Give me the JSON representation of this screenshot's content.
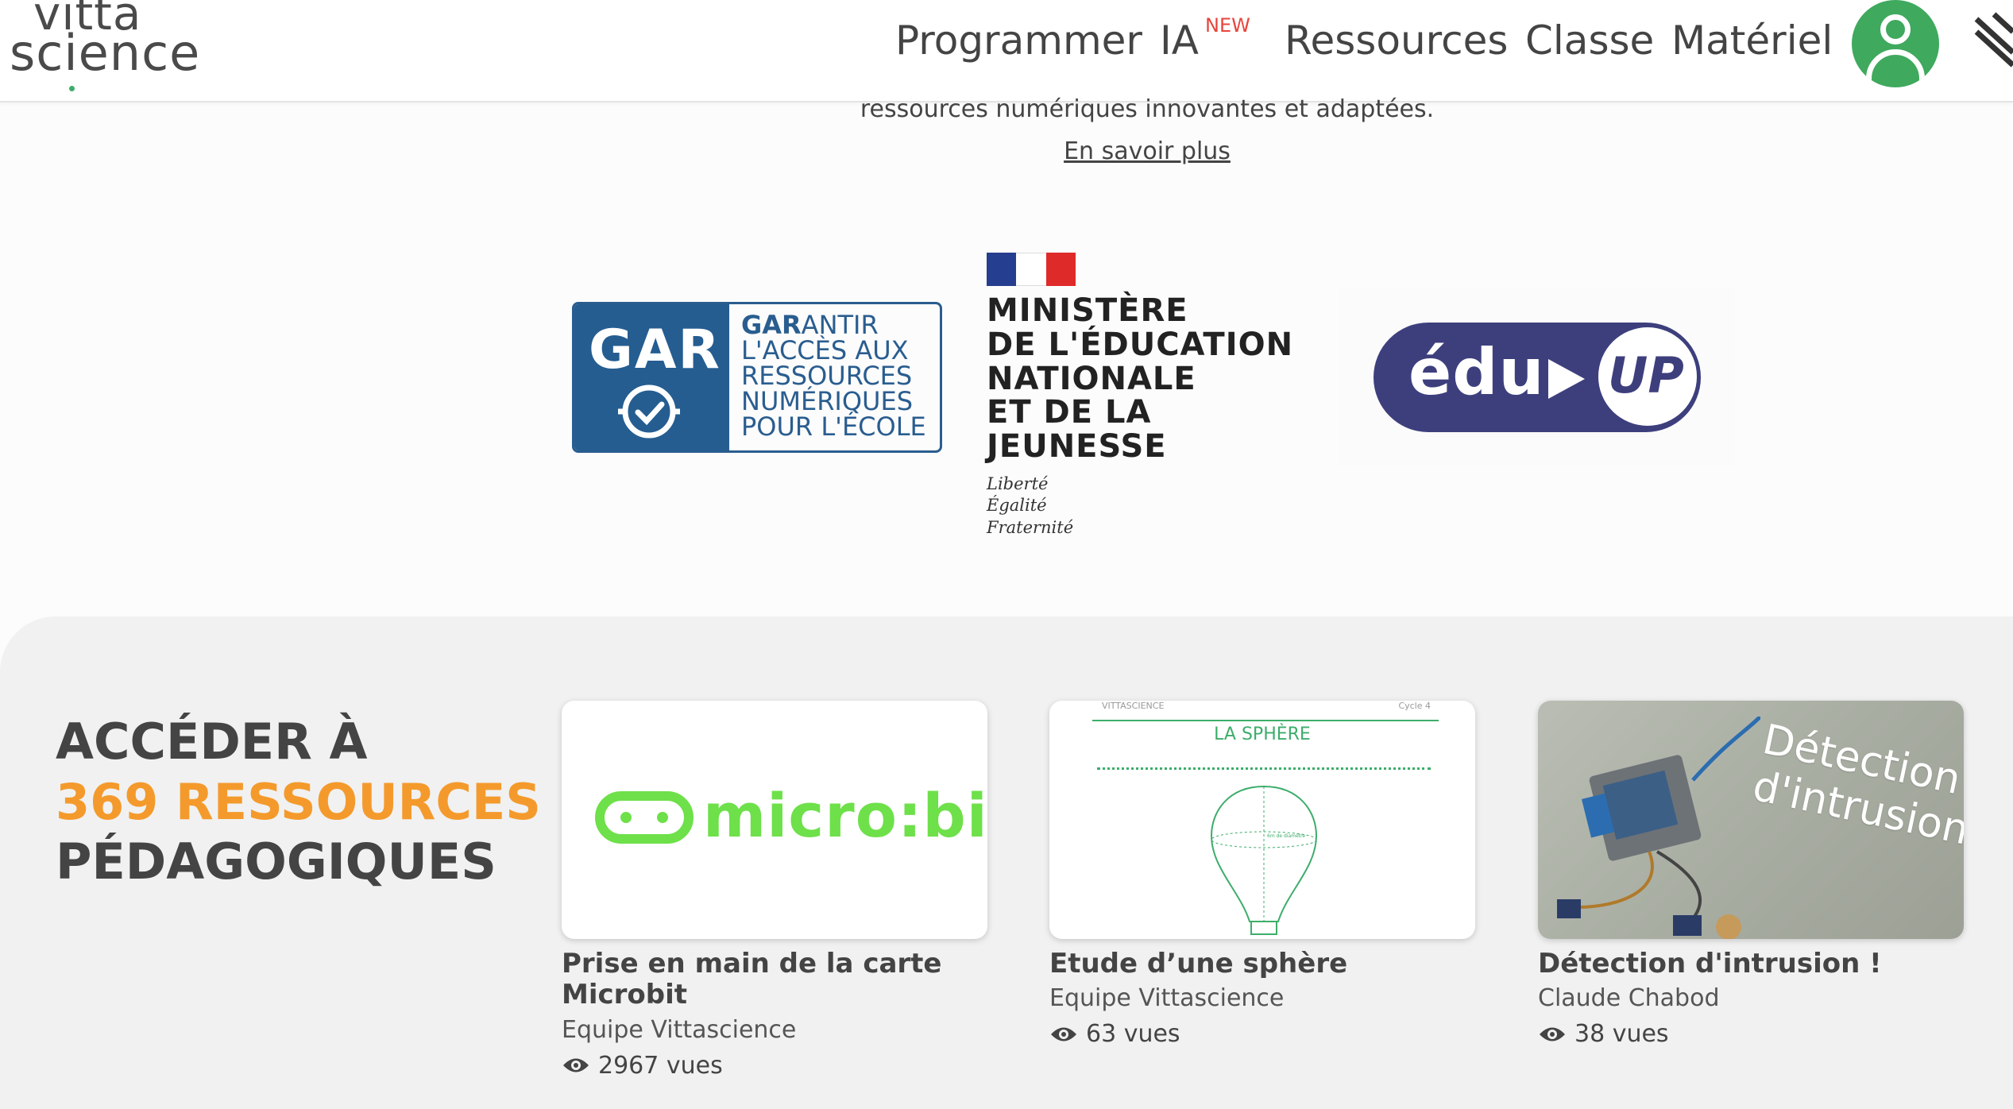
{
  "header": {
    "logo_line1": "vitta",
    "logo_line2_a": "sc",
    "logo_line2_i": "i",
    "logo_line2_b": "ence",
    "nav": [
      "Programmer",
      "IA",
      "Ressources",
      "Classe",
      "Matériel"
    ],
    "ia_badge": "NEW"
  },
  "intro": {
    "text": "ressources numériques innovantes et adaptées.",
    "link": "En savoir plus"
  },
  "partners": {
    "gar": {
      "short": "GAR",
      "lines": [
        "ANTIR",
        "L'ACCÈS AUX",
        "RESSOURCES",
        "NUMÉRIQUES",
        "POUR L'ÉCOLE"
      ],
      "lead": "GAR"
    },
    "ministry": {
      "title": [
        "MINISTÈRE",
        "DE L'ÉDUCATION",
        "NATIONALE",
        "ET DE LA JEUNESSE"
      ],
      "motto": [
        "Liberté",
        "Égalité",
        "Fraternité"
      ]
    },
    "eduup": {
      "edu": "édu",
      "up": "UP"
    }
  },
  "section": {
    "line1": "ACCÉDER À",
    "line2": "369 RESSOURCES",
    "line3": "PÉDAGOGIQUES"
  },
  "cards": [
    {
      "thumb_text": "micro:bit",
      "title": "Prise en main de la carte Microbit",
      "author": "Equipe Vittascience",
      "views": "2967 vues"
    },
    {
      "thumb_header": "VITTASCIENCE",
      "thumb_cycle": "Cycle 4",
      "thumb_title": "LA SPHÈRE",
      "thumb_note": "6m de diamètre",
      "title": "Etude d’une sphère",
      "author": "Equipe Vittascience",
      "views": "63 vues"
    },
    {
      "thumb_text": "Détection d'intrusion",
      "title": "Détection d'intrusion !",
      "author": "Claude Chabod",
      "views": "38 vues"
    }
  ],
  "colors": {
    "brand_green": "#3dad6b",
    "accent_orange": "#f49a2c",
    "new_red": "#e8453c"
  }
}
